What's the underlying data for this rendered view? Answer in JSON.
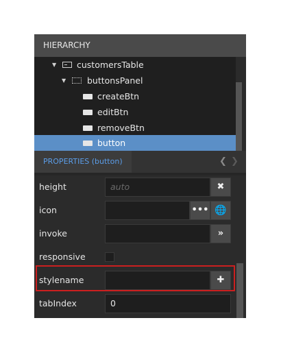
{
  "hierarchy": {
    "title": "HIERARCHY",
    "items": [
      {
        "label": "customersTable",
        "icon": "table-icon",
        "expanded": true
      },
      {
        "label": "buttonsPanel",
        "icon": "panel-icon",
        "expanded": true
      },
      {
        "label": "createBtn",
        "icon": "button-icon"
      },
      {
        "label": "editBtn",
        "icon": "button-icon"
      },
      {
        "label": "removeBtn",
        "icon": "button-icon"
      },
      {
        "label": "button",
        "icon": "button-icon",
        "selected": true
      }
    ]
  },
  "properties": {
    "tab_label": "PROPERTIES (button)",
    "rows": [
      {
        "name": "height",
        "value": "",
        "placeholder": "auto",
        "button": "clear-icon"
      },
      {
        "name": "icon",
        "value": "",
        "buttons": [
          "ellipsis-icon",
          "globe-icon"
        ]
      },
      {
        "name": "invoke",
        "value": "",
        "button": "double-chevron-right-icon"
      },
      {
        "name": "responsive",
        "checked": false
      },
      {
        "name": "stylename",
        "value": "",
        "button": "plus-icon",
        "highlighted": true
      },
      {
        "name": "tabIndex",
        "value": "0"
      }
    ]
  },
  "colors": {
    "selection": "#5b8fc7",
    "tab_accent": "#5b9de8",
    "highlight_box": "#cc1f1f"
  }
}
